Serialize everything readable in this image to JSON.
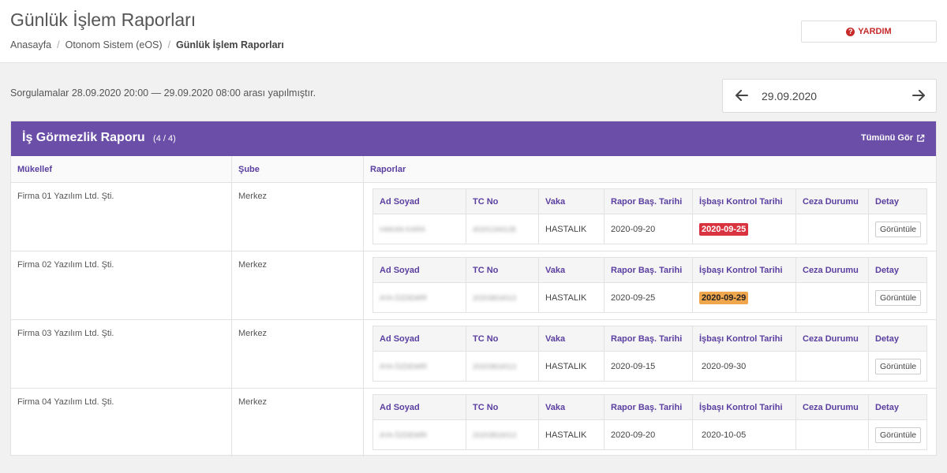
{
  "header": {
    "title": "Günlük İşlem Raporları",
    "breadcrumb": [
      "Anasayfa",
      "Otonom Sistem (eOS)",
      "Günlük İşlem Raporları"
    ],
    "help_label": "YARDIM"
  },
  "query": {
    "text": "Sorgulamalar 28.09.2020 20:00 — 29.09.2020 08:00 arası yapılmıştır.",
    "date": "29.09.2020"
  },
  "panel": {
    "title": "İş Görmezlik Raporu",
    "count": "(4 / 4)",
    "see_all": "Tümünü Gör",
    "columns": [
      "Mükellef",
      "Şube",
      "Raporlar"
    ],
    "sub_columns": [
      "Ad Soyad",
      "TC No",
      "Vaka",
      "Rapor Baş. Tarihi",
      "İşbaşı Kontrol Tarihi",
      "Ceza Durumu",
      "Detay"
    ],
    "rows": [
      {
        "company": "Firma 01 Yazılım Ltd. Şti.",
        "branch": "Merkez",
        "report": {
          "name": "HAKAN KARA",
          "tc": "40201344135",
          "case": "HASTALIK",
          "start": "2020-09-20",
          "control": "2020-09-25",
          "penalty": "",
          "detail": "Görüntüle"
        }
      },
      {
        "company": "Firma 02 Yazılım Ltd. Şti.",
        "branch": "Merkez",
        "report": {
          "name": "AYA ÖZDEMİR",
          "tc": "20203816013",
          "case": "HASTALIK",
          "start": "2020-09-25",
          "control": "2020-09-29",
          "penalty": "",
          "detail": "Görüntüle"
        }
      },
      {
        "company": "Firma 03 Yazılım Ltd. Şti.",
        "branch": "Merkez",
        "report": {
          "name": "AYA ÖZDEMİR",
          "tc": "20203816013",
          "case": "HASTALIK",
          "start": "2020-09-15",
          "control": "2020-09-30",
          "penalty": "",
          "detail": "Görüntüle"
        }
      },
      {
        "company": "Firma 04 Yazılım Ltd. Şti.",
        "branch": "Merkez",
        "report": {
          "name": "AYA ÖZDEMİR",
          "tc": "20203816013",
          "case": "HASTALIK",
          "start": "2020-09-20",
          "control": "2020-10-05",
          "penalty": "",
          "detail": "Görüntüle"
        }
      }
    ]
  },
  "colors": {
    "accent": "#6b4ea8",
    "header_text": "#5b3fa0",
    "badge_red": "#d9333f",
    "badge_orange": "#f0a64c",
    "help_red": "#c62a2a"
  }
}
